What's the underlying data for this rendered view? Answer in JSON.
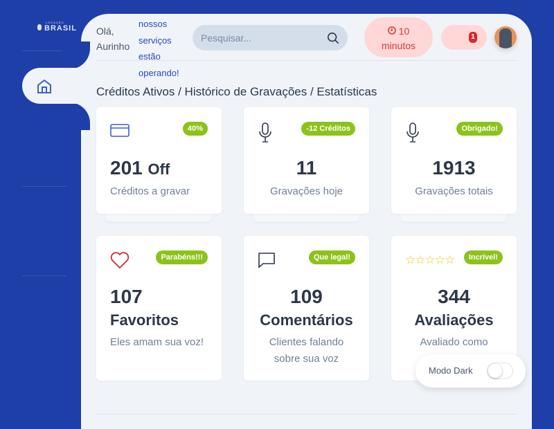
{
  "brand": {
    "logo_text": "BRASIL",
    "logo_small": "LOCAÇÃO"
  },
  "header": {
    "greeting": "Olá, Aurinho",
    "status": "nossos serviços estão operando!",
    "search_placeholder": "Pesquisar...",
    "timer_value": "10",
    "timer_unit": "minutos",
    "notification_count": "1"
  },
  "page_title": "Créditos Ativos / Histórico de Gravações / Estatísticas",
  "cards": [
    {
      "badge": "40%",
      "value": "201",
      "value_suffix": "Off",
      "description": "Créditos a gravar",
      "icon": "credit-card-icon"
    },
    {
      "badge": "-12 Créditos",
      "value": "11",
      "description": "Gravações hoje",
      "icon": "microphone-icon"
    },
    {
      "badge": "Obrigado!",
      "value": "1913",
      "description": "Gravações totais",
      "icon": "microphone-icon"
    },
    {
      "badge": "Parabéns!!!",
      "value": "107",
      "label": "Favoritos",
      "description": "Eles amam sua voz!",
      "icon": "heart-icon"
    },
    {
      "badge": "Que legal!",
      "value": "109",
      "label": "Comentários",
      "description": "Clientes falando sobre sua voz",
      "icon": "chat-icon"
    },
    {
      "badge": "Incrível!",
      "value": "344",
      "label": "Avaliações",
      "description": "Avaliado como",
      "icon": "stars-icon",
      "stars": "☆☆☆☆☆"
    }
  ],
  "dark_mode": {
    "label": "Modo Dark",
    "enabled": false
  },
  "colors": {
    "primary": "#1e3ea8",
    "badge": "#8cc21a",
    "alert": "#ffd7d6"
  }
}
